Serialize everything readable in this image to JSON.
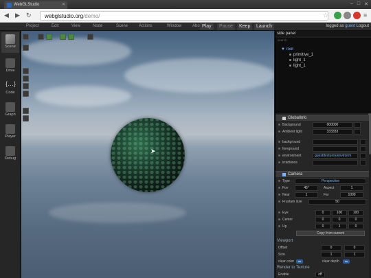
{
  "browser": {
    "tab_title": "WebGLStudio",
    "url_host": "webglstudio.org",
    "url_path": "/demo/"
  },
  "appbar": {
    "menu": [
      "Project",
      "Edit",
      "View",
      "Node",
      "Scene",
      "Actions",
      "Window",
      "Abo"
    ],
    "play": "Play",
    "pause": "Pause",
    "keep": "Keep",
    "launch": "Launch",
    "logged_as": "logged as",
    "user": "guest",
    "logout": "Logout"
  },
  "leftbar": [
    {
      "label": "Scene",
      "icon": "cube-icon"
    },
    {
      "label": "Drive",
      "icon": "drive-icon"
    },
    {
      "label": "Code",
      "icon": "braces-icon"
    },
    {
      "label": "Graph",
      "icon": "graph-icon"
    },
    {
      "label": "Player",
      "icon": "player-icon"
    },
    {
      "label": "Debug",
      "icon": "debug-icon"
    }
  ],
  "side_panel": {
    "title": "side panel",
    "search_hint": "search",
    "tree": {
      "root": "root",
      "children": [
        "primitive_1",
        "light_1",
        "light_1"
      ]
    },
    "global_info": {
      "title": "GlobalInfo",
      "background_label": "Background",
      "background_value": "000000",
      "ambient_label": "Ambient light",
      "ambient_value": "333333",
      "tex_labels": [
        "background",
        "foreground",
        "environment",
        "irradiance"
      ],
      "environment_value": "guest/textures/environm"
    },
    "camera": {
      "title": "Camera",
      "type_label": "Type",
      "type_value": "Perspective",
      "fov_label": "Fov",
      "fov_value": "45°",
      "aspect_label": "Aspect",
      "aspect_value": "1",
      "near_label": "Near",
      "near_value": "1",
      "far_label": "Far",
      "far_value": "1000",
      "frustum_label": "Frustum size",
      "frustum_value": "50",
      "eye_label": "Eye",
      "eye_values": [
        "0",
        "100",
        "100"
      ],
      "center_label": "Center",
      "center_values": [
        "0",
        "0",
        "0"
      ],
      "up_label": "Up",
      "up_values": [
        "0",
        "1",
        "0"
      ],
      "copy_button": "Copy from current",
      "viewport_label": "Viewport",
      "offset_label": "Offset",
      "offset_values": [
        "0",
        "0"
      ],
      "size_label": "Size",
      "size_values": [
        "1",
        "1"
      ],
      "clear_color_label": "clear color",
      "clear_color_toggle": "on",
      "clear_depth_label": "clear depth",
      "clear_depth_toggle": "on",
      "render_to_texture": "Render to Texture",
      "enable_label": "Enable",
      "enable_value": "off"
    }
  },
  "colors": {
    "accent": "#7ab4ff",
    "toggle_on": "#2b5fa0"
  }
}
